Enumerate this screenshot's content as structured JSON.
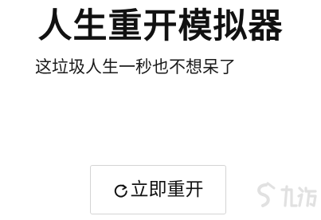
{
  "header": {
    "title": "人生重开模拟器",
    "subtitle": "这垃圾人生一秒也不想呆了"
  },
  "main": {
    "restart_label": "立即重开",
    "restart_icon": "refresh-icon"
  },
  "watermark": {
    "brand": "九游",
    "icon": "jiuyou-logo"
  }
}
